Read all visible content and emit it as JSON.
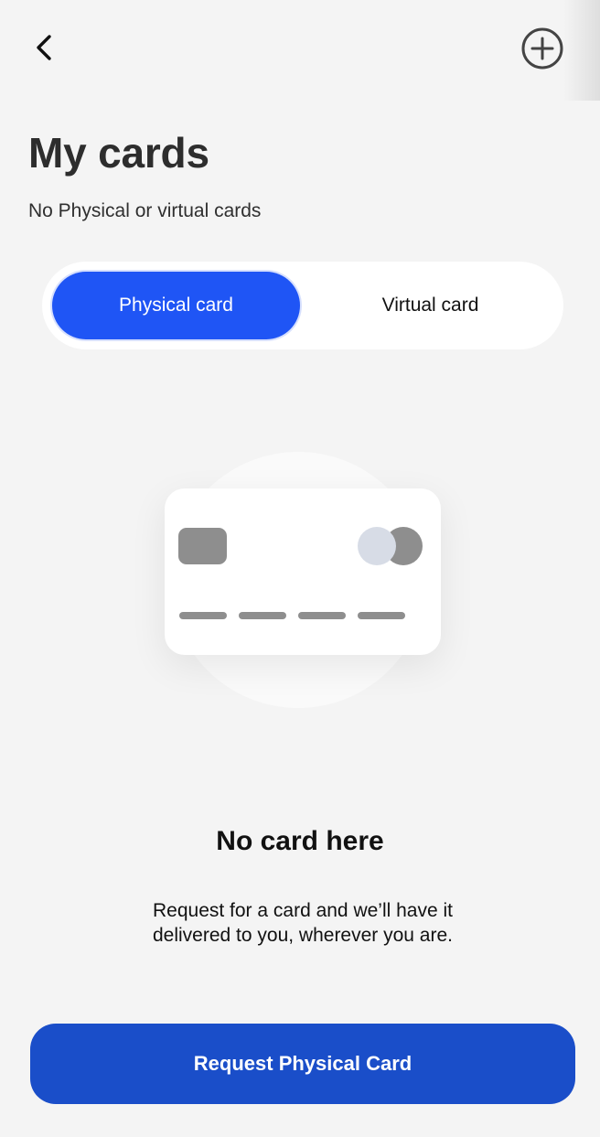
{
  "header": {
    "back_icon": "chevron-left-icon",
    "add_icon": "plus-circle-icon"
  },
  "page": {
    "title": "My cards",
    "subtitle": "No Physical or virtual cards"
  },
  "tabs": [
    {
      "label": "Physical card",
      "active": true
    },
    {
      "label": "Virtual card",
      "active": false
    }
  ],
  "illustration": {
    "icon": "credit-card-icon"
  },
  "empty_state": {
    "title": "No card here",
    "description_line1": "Request for a card and we’ll have it",
    "description_line2": "delivered to you, wherever you are."
  },
  "cta": {
    "label": "Request Physical Card"
  },
  "colors": {
    "background": "#f4f4f4",
    "active_tab": "#1f55f5",
    "cta": "#1a4ec9",
    "card_placeholder": "#8e8e8e",
    "card_logo_light": "#d7dce6"
  }
}
